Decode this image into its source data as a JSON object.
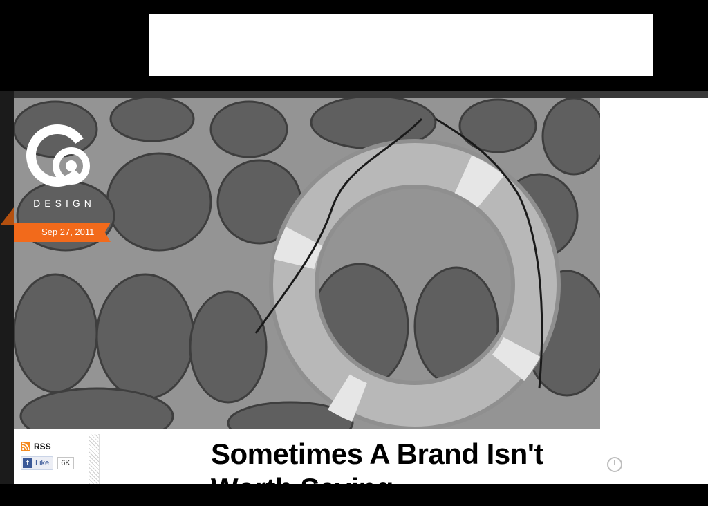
{
  "ad": {
    "content": ""
  },
  "logo": {
    "word": "DESIGN"
  },
  "post": {
    "date": "Sep 27, 2011",
    "title": "Sometimes A Brand Isn't Worth Saving"
  },
  "social": {
    "rss_label": "RSS",
    "like_label": "Like",
    "like_count": "6K"
  },
  "icons": [
    "rss-icon",
    "facebook-icon",
    "clock-icon"
  ],
  "colors": {
    "background": "#000000",
    "page": "#ffffff",
    "accent_orange": "#f26a1b",
    "facebook_blue": "#3b5998"
  }
}
